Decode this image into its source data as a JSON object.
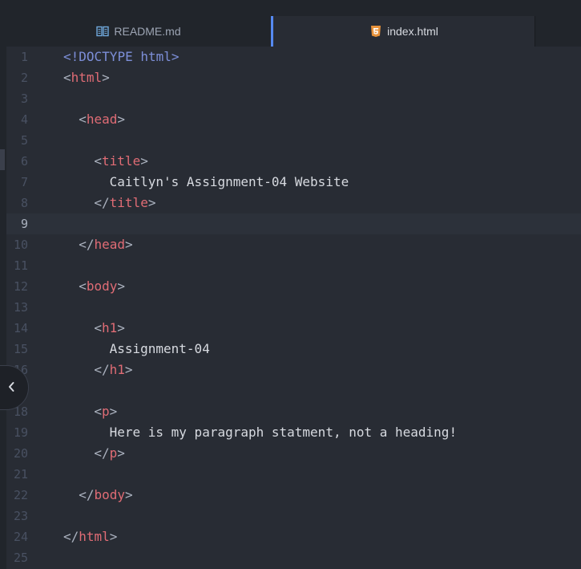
{
  "tabs": [
    {
      "label": "README.md",
      "icon": "book-icon",
      "active": false
    },
    {
      "label": "index.html",
      "icon": "html5-icon",
      "active": true
    }
  ],
  "editor": {
    "cursor_line": 9,
    "lines": [
      {
        "num": "1",
        "indent": 0,
        "tokens": [
          {
            "t": "<",
            "k": "tag-doctype"
          },
          {
            "t": "!DOCTYPE html",
            "k": "tag-doctype"
          },
          {
            "t": ">",
            "k": "tag-doctype"
          }
        ]
      },
      {
        "num": "2",
        "indent": 0,
        "tokens": [
          {
            "t": "<",
            "k": "punct"
          },
          {
            "t": "html",
            "k": "tag"
          },
          {
            "t": ">",
            "k": "punct"
          }
        ]
      },
      {
        "num": "3",
        "indent": 0,
        "tokens": []
      },
      {
        "num": "4",
        "indent": 1,
        "tokens": [
          {
            "t": "<",
            "k": "punct"
          },
          {
            "t": "head",
            "k": "tag"
          },
          {
            "t": ">",
            "k": "punct"
          }
        ]
      },
      {
        "num": "5",
        "indent": 0,
        "tokens": []
      },
      {
        "num": "6",
        "indent": 2,
        "tokens": [
          {
            "t": "<",
            "k": "punct"
          },
          {
            "t": "title",
            "k": "tag"
          },
          {
            "t": ">",
            "k": "punct"
          }
        ]
      },
      {
        "num": "7",
        "indent": 3,
        "tokens": [
          {
            "t": "Caitlyn's Assignment-04 Website",
            "k": "text-content"
          }
        ]
      },
      {
        "num": "8",
        "indent": 2,
        "tokens": [
          {
            "t": "</",
            "k": "punct"
          },
          {
            "t": "title",
            "k": "tag"
          },
          {
            "t": ">",
            "k": "punct"
          }
        ]
      },
      {
        "num": "9",
        "indent": 0,
        "tokens": []
      },
      {
        "num": "10",
        "indent": 1,
        "tokens": [
          {
            "t": "</",
            "k": "punct"
          },
          {
            "t": "head",
            "k": "tag"
          },
          {
            "t": ">",
            "k": "punct"
          }
        ]
      },
      {
        "num": "11",
        "indent": 0,
        "tokens": []
      },
      {
        "num": "12",
        "indent": 1,
        "tokens": [
          {
            "t": "<",
            "k": "punct"
          },
          {
            "t": "body",
            "k": "tag"
          },
          {
            "t": ">",
            "k": "punct"
          }
        ]
      },
      {
        "num": "13",
        "indent": 0,
        "tokens": []
      },
      {
        "num": "14",
        "indent": 2,
        "tokens": [
          {
            "t": "<",
            "k": "punct"
          },
          {
            "t": "h1",
            "k": "tag"
          },
          {
            "t": ">",
            "k": "punct"
          }
        ]
      },
      {
        "num": "15",
        "indent": 3,
        "tokens": [
          {
            "t": "Assignment-04",
            "k": "text-content"
          }
        ]
      },
      {
        "num": "16",
        "indent": 2,
        "tokens": [
          {
            "t": "</",
            "k": "punct"
          },
          {
            "t": "h1",
            "k": "tag"
          },
          {
            "t": ">",
            "k": "punct"
          }
        ]
      },
      {
        "num": "17",
        "indent": 0,
        "tokens": []
      },
      {
        "num": "18",
        "indent": 2,
        "tokens": [
          {
            "t": "<",
            "k": "punct"
          },
          {
            "t": "p",
            "k": "tag"
          },
          {
            "t": ">",
            "k": "punct"
          }
        ]
      },
      {
        "num": "19",
        "indent": 3,
        "tokens": [
          {
            "t": "Here is my paragraph statment, not a heading!",
            "k": "text-content"
          }
        ]
      },
      {
        "num": "20",
        "indent": 2,
        "tokens": [
          {
            "t": "</",
            "k": "punct"
          },
          {
            "t": "p",
            "k": "tag"
          },
          {
            "t": ">",
            "k": "punct"
          }
        ]
      },
      {
        "num": "21",
        "indent": 0,
        "tokens": []
      },
      {
        "num": "22",
        "indent": 1,
        "tokens": [
          {
            "t": "</",
            "k": "punct"
          },
          {
            "t": "body",
            "k": "tag"
          },
          {
            "t": ">",
            "k": "punct"
          }
        ]
      },
      {
        "num": "23",
        "indent": 0,
        "tokens": []
      },
      {
        "num": "24",
        "indent": 0,
        "tokens": [
          {
            "t": "</",
            "k": "punct"
          },
          {
            "t": "html",
            "k": "tag"
          },
          {
            "t": ">",
            "k": "punct"
          }
        ]
      },
      {
        "num": "25",
        "indent": 0,
        "tokens": []
      }
    ]
  },
  "panel_toggle": {
    "icon": "chevron-left-icon"
  },
  "colors": {
    "background": "#282c34",
    "tag": "#e06c75",
    "doctype": "#7d8fd9",
    "text": "#d7dae0",
    "active_tab_border": "#568af2",
    "html5_icon": "#e8923a",
    "book_icon": "#6fa8dc"
  }
}
